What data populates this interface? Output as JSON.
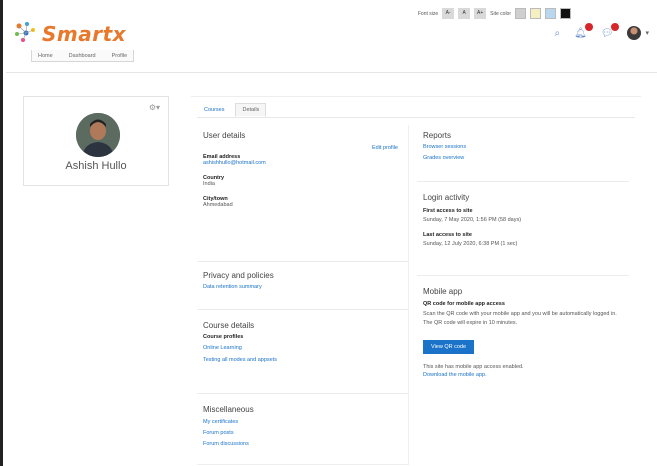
{
  "a11y_toolbar": {
    "font_size_label": "Font size",
    "font_buttons": [
      "A-",
      "A",
      "A+"
    ],
    "site_color_label": "Site color",
    "swatches": [
      "#cfcfcf",
      "#f5f0c2",
      "#b9d8f0",
      "#111111"
    ]
  },
  "brand": {
    "name": "Smartx",
    "color": "#e8782b"
  },
  "header_icons": [
    "search-icon",
    "bell-icon",
    "chat-icon",
    "user-avatar"
  ],
  "breadcrumb": [
    "Home",
    "Dashboard",
    "Profile"
  ],
  "profile": {
    "name": "Ashish Hullo"
  },
  "tabs": [
    "Courses",
    "Details"
  ],
  "user_details": {
    "title": "User details",
    "edit_link": "Edit profile",
    "email_label": "Email address",
    "email": "ashishhullo@hotmail.com",
    "country_label": "Country",
    "country": "India",
    "city_label": "City/town",
    "city": "Ahmedabad"
  },
  "privacy": {
    "title": "Privacy and policies",
    "link": "Data retention summary"
  },
  "course_details": {
    "title": "Course details",
    "label": "Course profiles",
    "links": [
      "Online Learning",
      "Testing all modes and appsets"
    ]
  },
  "misc": {
    "title": "Miscellaneous",
    "links": [
      "My certificates",
      "Forum posts",
      "Forum discussions"
    ]
  },
  "reports": {
    "title": "Reports",
    "links": [
      "Browser sessions",
      "Grades overview"
    ]
  },
  "login": {
    "title": "Login activity",
    "first_label": "First access to site",
    "first_value": "Sunday, 7 May 2020, 1:56 PM (58 days)",
    "last_label": "Last access to site",
    "last_value": "Sunday, 12 July 2020, 6:38 PM (1 sec)"
  },
  "mobile": {
    "title": "Mobile app",
    "qr_label": "QR code for mobile app access",
    "qr_desc": "Scan the QR code with your mobile app and you will be automatically logged in. The QR code will expire in 10 minutes.",
    "button": "View QR code",
    "enabled_text": "This site has mobile app access enabled.",
    "download_link": "Download the mobile app."
  }
}
